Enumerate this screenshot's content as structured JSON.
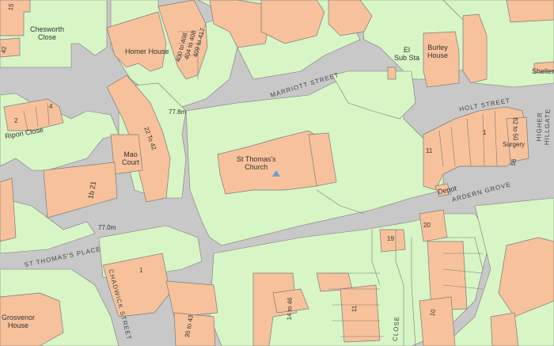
{
  "colors": {
    "road": "#c8c8c8",
    "green": "#d8f5c6",
    "building": "#f7c29b",
    "outline": "#7a7a7a",
    "church_marker": "#6a9ecf"
  },
  "labels": {
    "chesworth_close": "Chesworth\nClose",
    "homer_house": "Homer House",
    "flats_400": "400 to 408",
    "flats_404": "404 to 408",
    "flats_409": "409 to 417",
    "el_sub_sta": "El\nSub Sta",
    "burley_house": "Burley\nHouse",
    "shelter": "Shelter",
    "marriott_street": "MARRIOTT STREET",
    "level_778": "77.8m",
    "holt_street": "HOLT STREET",
    "higher_hillgate": "HIGHER\nHILLGATE",
    "ripon_close": "Ripon Close",
    "block_22_42": "22 To 42",
    "mao_court": "Mao\nCourt",
    "church": "St Thomas's\nChurch",
    "no_2": "2",
    "no_4": "4",
    "no_11": "11",
    "no_1": "1",
    "no_62_50": "62 to 50",
    "surgery": "Surgery",
    "no_56": "56",
    "depot": "Depot",
    "ardern_grove": "ARDERN GROVE",
    "block_1b_21": "1b 21",
    "level_770": "77.0m",
    "no_19": "19",
    "no_20": "20",
    "st_thomass_place": "ST THOMAS'S PLACE",
    "chadwick_street": "CHADWICK STREET",
    "no_1_south": "1",
    "grosvenor_house": "Grosvenor\nHouse",
    "block_35_43": "35 to 43",
    "block_14_46": "14 to 46",
    "no_11_south": "11",
    "close": "CLOSE",
    "no_10": "10",
    "no_42": "42",
    "no_15": "15"
  }
}
